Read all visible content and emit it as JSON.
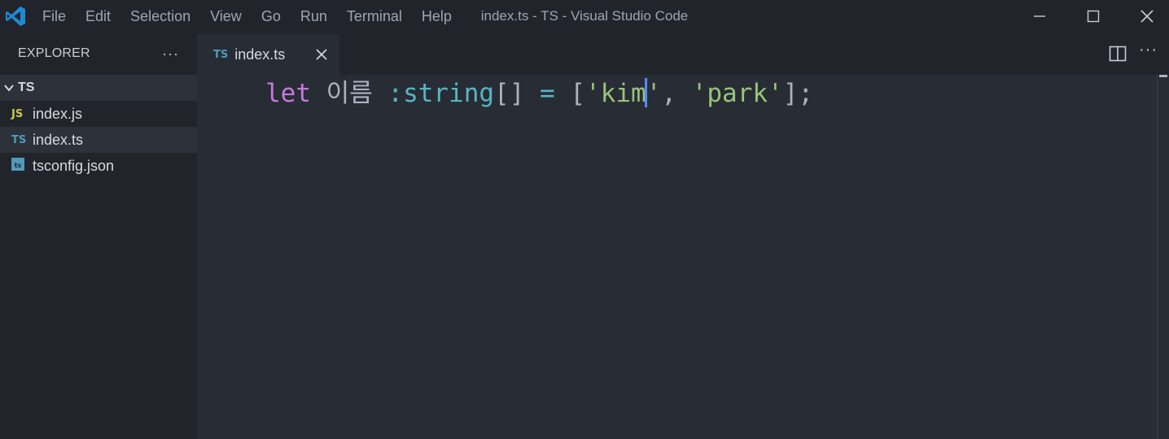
{
  "titlebar": {
    "menus": [
      "File",
      "Edit",
      "Selection",
      "View",
      "Go",
      "Run",
      "Terminal",
      "Help"
    ],
    "window_title": "index.ts - TS - Visual Studio Code"
  },
  "sidebar": {
    "title": "EXPLORER",
    "more": "···",
    "folder": "TS",
    "files": [
      {
        "icon": "JS",
        "name": "index.js",
        "icon_color": "#cbcb41"
      },
      {
        "icon": "TS",
        "name": "index.ts",
        "icon_color": "#519aba"
      },
      {
        "icon": "tsconfig-icon",
        "name": "tsconfig.json",
        "icon_color": "#519aba"
      }
    ]
  },
  "tabs": {
    "active": {
      "icon": "TS",
      "label": "index.ts"
    },
    "more": "···"
  },
  "editor": {
    "line1": {
      "keyword": "let",
      "name": "이름",
      "colon": ":",
      "type": "string",
      "brackets": "[]",
      "equals": "=",
      "open": "[",
      "str1_a": "'kim",
      "str1_b": "'",
      "comma": ",",
      "str2": "'park'",
      "close": "];"
    }
  },
  "colors": {
    "accent": "#528bff",
    "keyword": "#c678dd",
    "type": "#56b6c2",
    "string": "#98c379"
  }
}
